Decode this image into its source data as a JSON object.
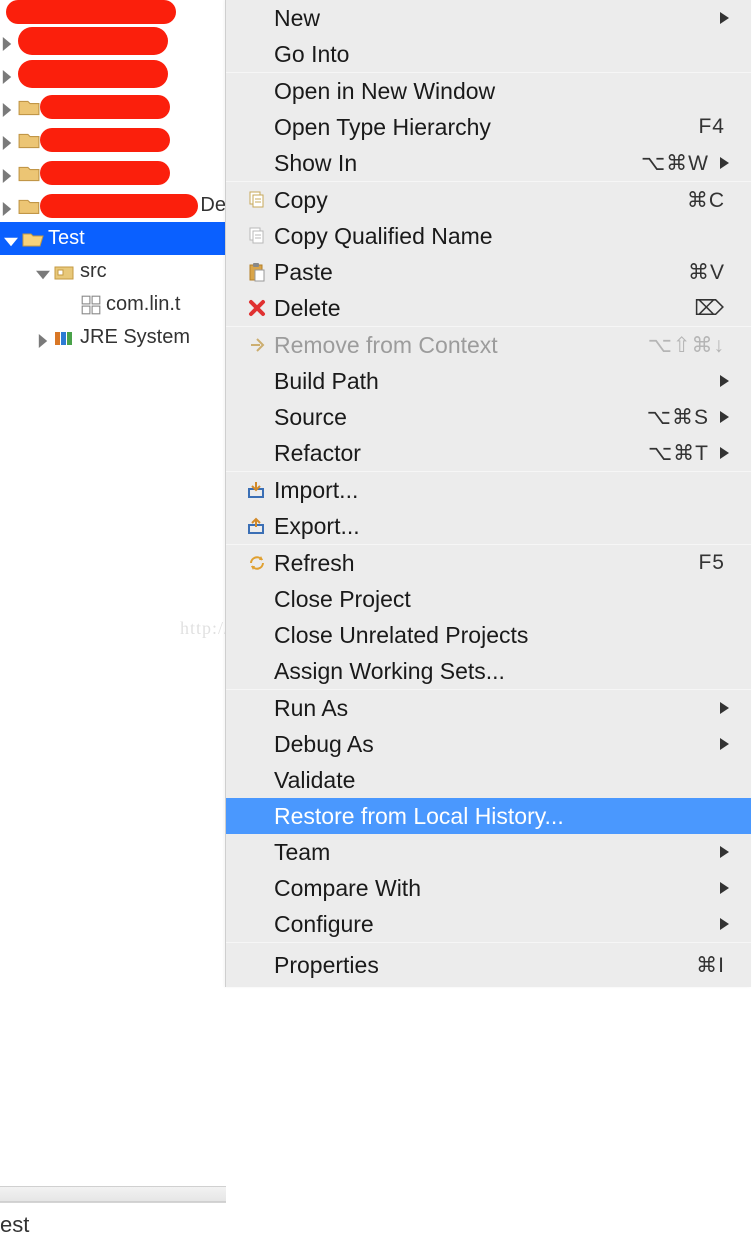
{
  "tree": {
    "selected": "Test",
    "src": "src",
    "pkg": "com.lin.t",
    "jre": "JRE System",
    "extraDe": "De"
  },
  "bottomTab": "est",
  "watermark": "http://blog.csdn.net/MinggeQingchun",
  "menu": {
    "new": "New",
    "goInto": "Go Into",
    "openNewWindow": "Open in New Window",
    "openTypeHierarchy": "Open Type Hierarchy",
    "openTypeHierarchyShort": "F4",
    "showIn": "Show In",
    "showInShort": "⌥⌘W",
    "copy": "Copy",
    "copyShort": "⌘C",
    "copyQualified": "Copy Qualified Name",
    "paste": "Paste",
    "pasteShort": "⌘V",
    "delete": "Delete",
    "deleteShort": "⌦",
    "removeContext": "Remove from Context",
    "removeContextShort": "⌥⇧⌘↓",
    "buildPath": "Build Path",
    "source": "Source",
    "sourceShort": "⌥⌘S",
    "refactor": "Refactor",
    "refactorShort": "⌥⌘T",
    "import": "Import...",
    "export": "Export...",
    "refresh": "Refresh",
    "refreshShort": "F5",
    "closeProject": "Close Project",
    "closeUnrelated": "Close Unrelated Projects",
    "assignWorkingSets": "Assign Working Sets...",
    "runAs": "Run As",
    "debugAs": "Debug As",
    "validate": "Validate",
    "restoreHistory": "Restore from Local History...",
    "team": "Team",
    "compareWith": "Compare With",
    "configure": "Configure",
    "properties": "Properties",
    "propertiesShort": "⌘I"
  }
}
